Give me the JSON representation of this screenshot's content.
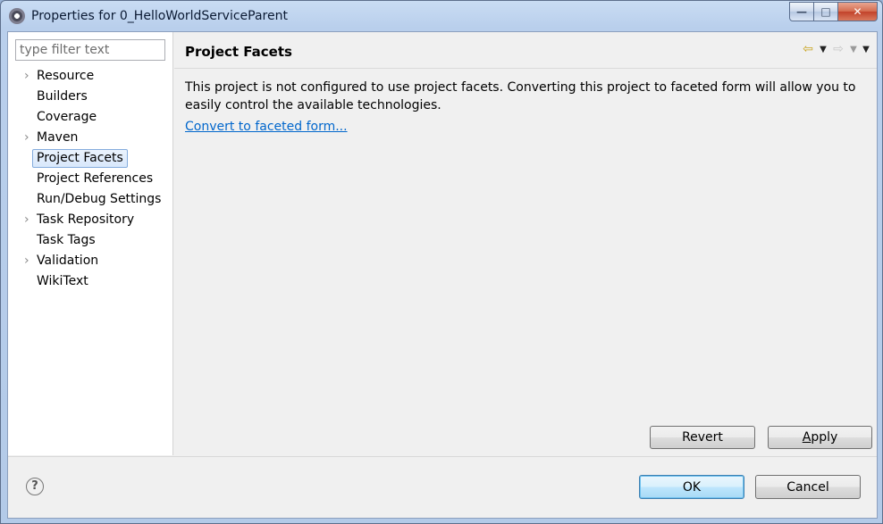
{
  "window": {
    "title": "Properties for 0_HelloWorldServiceParent",
    "controls": {
      "minimize": "—",
      "maximize": "□",
      "close": "✕"
    }
  },
  "left_panel": {
    "filter_placeholder": "type filter text",
    "tree_items": [
      {
        "label": "Resource",
        "expandable": true,
        "selected": false
      },
      {
        "label": "Builders",
        "expandable": false,
        "selected": false
      },
      {
        "label": "Coverage",
        "expandable": false,
        "selected": false
      },
      {
        "label": "Maven",
        "expandable": true,
        "selected": false
      },
      {
        "label": "Project Facets",
        "expandable": false,
        "selected": true
      },
      {
        "label": "Project References",
        "expandable": false,
        "selected": false
      },
      {
        "label": "Run/Debug Settings",
        "expandable": false,
        "selected": false
      },
      {
        "label": "Task Repository",
        "expandable": true,
        "selected": false
      },
      {
        "label": "Task Tags",
        "expandable": false,
        "selected": false
      },
      {
        "label": "Validation",
        "expandable": true,
        "selected": false
      },
      {
        "label": "WikiText",
        "expandable": false,
        "selected": false
      }
    ],
    "expand_glyph": "›"
  },
  "page": {
    "title": "Project Facets",
    "description": "This project is not configured to use project facets. Converting this project to faceted form will allow you to easily control the available technologies.",
    "convert_link": "Convert to faceted form...",
    "nav": {
      "back_icon": "⇦",
      "forward_icon": "⇨",
      "dropdown": "▼"
    },
    "revert_label": "Revert",
    "apply_label_mnemonic": "A",
    "apply_label_rest": "pply"
  },
  "footer": {
    "help_glyph": "?",
    "ok_label": "OK",
    "cancel_label": "Cancel"
  },
  "colors": {
    "link": "#0066cc",
    "back_arrow": "#c7a21b",
    "selection_border": "#84acdd"
  }
}
